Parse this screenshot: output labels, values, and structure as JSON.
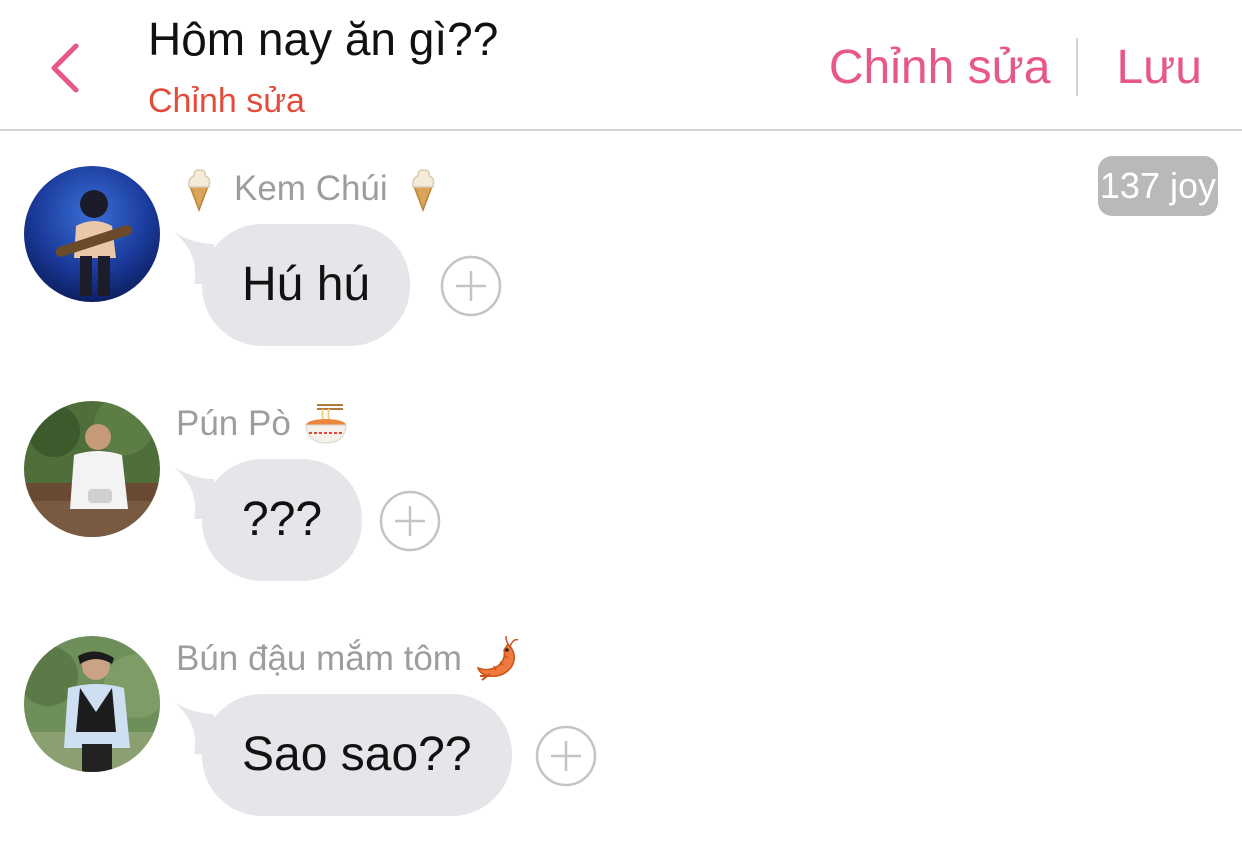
{
  "header": {
    "title": "Hôm nay ăn gì??",
    "subtitle": "Chỉnh sửa",
    "edit_label": "Chỉnh sửa",
    "save_label": "Lưu"
  },
  "badge": "137 joy",
  "messages": [
    {
      "sender": "Kem Chúi",
      "text": "Hú hú",
      "sender_icons": [
        "ice-cream-icon",
        "ice-cream-icon"
      ]
    },
    {
      "sender": "Pún Pò",
      "text": "???",
      "sender_icons": [
        "noodle-bowl-icon"
      ]
    },
    {
      "sender": "Bún đậu mắm tôm",
      "text": "Sao sao??",
      "sender_icons": [
        "shrimp-icon"
      ]
    }
  ],
  "colors": {
    "accent": "#e8578a",
    "subtitle": "#e34b3b",
    "bubble": "#e5e6ea",
    "badge": "#b9b9bb",
    "sender": "#9d9da1"
  }
}
